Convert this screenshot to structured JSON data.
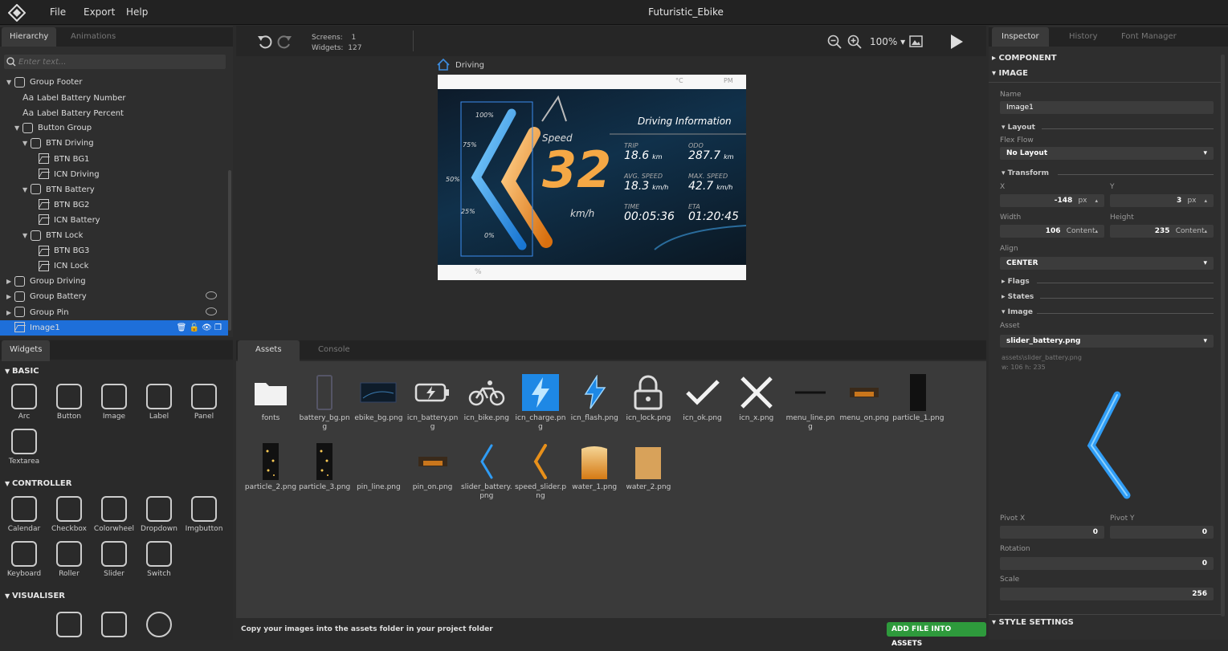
{
  "app": {
    "title": "Futuristic_Ebike",
    "menu": [
      "File",
      "Export",
      "Help"
    ]
  },
  "left_tabs": [
    "Hierarchy",
    "Animations"
  ],
  "search": {
    "placeholder": "Enter text..."
  },
  "hierarchy": [
    {
      "label": "Group Footer",
      "type": "group",
      "indent": 0,
      "expanded": true
    },
    {
      "label": "Label Battery Number",
      "type": "label",
      "indent": 1
    },
    {
      "label": "Label Battery Percent",
      "type": "label",
      "indent": 1
    },
    {
      "label": "Button Group",
      "type": "group",
      "indent": 1,
      "expanded": true
    },
    {
      "label": "BTN Driving",
      "type": "group",
      "indent": 2,
      "expanded": true
    },
    {
      "label": "BTN BG1",
      "type": "image",
      "indent": 3
    },
    {
      "label": "ICN Driving",
      "type": "image",
      "indent": 3
    },
    {
      "label": "BTN Battery",
      "type": "group",
      "indent": 2,
      "expanded": true
    },
    {
      "label": "BTN BG2",
      "type": "image",
      "indent": 3
    },
    {
      "label": "ICN Battery",
      "type": "image",
      "indent": 3
    },
    {
      "label": "BTN Lock",
      "type": "group",
      "indent": 2,
      "expanded": true
    },
    {
      "label": "BTN BG3",
      "type": "image",
      "indent": 3
    },
    {
      "label": "ICN Lock",
      "type": "image",
      "indent": 3
    },
    {
      "label": "Group Driving",
      "type": "group",
      "indent": 0,
      "expanded": false
    },
    {
      "label": "Group Battery",
      "type": "group",
      "indent": 0,
      "expanded": false,
      "hidden": true
    },
    {
      "label": "Group Pin",
      "type": "group",
      "indent": 0,
      "expanded": false,
      "hidden": true
    },
    {
      "label": "Image1",
      "type": "image",
      "indent": 0,
      "selected": true
    }
  ],
  "widgets_tab": "Widgets",
  "widget_sections": [
    {
      "name": "BASIC",
      "items": [
        "Arc",
        "Button",
        "Image",
        "Label",
        "Panel",
        "Textarea"
      ]
    },
    {
      "name": "CONTROLLER",
      "items": [
        "Calendar",
        "Checkbox",
        "Colorwheel",
        "Dropdown",
        "Imgbutton",
        "Keyboard",
        "Roller",
        "Slider",
        "Switch"
      ]
    },
    {
      "name": "VISUALISER",
      "items": []
    }
  ],
  "toolbar": {
    "screens_label": "Screens:",
    "screens": "1",
    "widgets_label": "Widgets:",
    "widgets": "127",
    "zoom": "100%"
  },
  "canvas": {
    "screen_name": "Driving",
    "header": {
      "temp_unit": "°C",
      "ampm": "PM"
    },
    "panel_title": "Driving Information",
    "speed_label": "Speed",
    "speed": "32",
    "speed_unit": "km/h",
    "scale": [
      "100%",
      "75%",
      "50%",
      "25%",
      "0%"
    ],
    "stats": [
      {
        "label": "TRIP",
        "value": "18.6",
        "unit": "km"
      },
      {
        "label": "ODO",
        "value": "287.7",
        "unit": "km"
      },
      {
        "label": "AVG. SPEED",
        "value": "18.3",
        "unit": "km/h"
      },
      {
        "label": "MAX. SPEED",
        "value": "42.7",
        "unit": "km/h"
      },
      {
        "label": "TIME",
        "value": "00:05:36",
        "unit": ""
      },
      {
        "label": "ETA",
        "value": "01:20:45",
        "unit": ""
      }
    ],
    "footer_percent": "%"
  },
  "bottom_tabs": [
    "Assets",
    "Console"
  ],
  "assets": [
    {
      "name": "fonts",
      "kind": "folder"
    },
    {
      "name": "battery_bg.png",
      "kind": "battery"
    },
    {
      "name": "ebike_bg.png",
      "kind": "bg"
    },
    {
      "name": "icn_battery.png",
      "kind": "icn_battery"
    },
    {
      "name": "icn_bike.png",
      "kind": "bike"
    },
    {
      "name": "icn_charge.png",
      "kind": "charge"
    },
    {
      "name": "icn_flash.png",
      "kind": "flash"
    },
    {
      "name": "icn_lock.png",
      "kind": "lock"
    },
    {
      "name": "icn_ok.png",
      "kind": "ok"
    },
    {
      "name": "icn_x.png",
      "kind": "x"
    },
    {
      "name": "menu_line.png",
      "kind": "line"
    },
    {
      "name": "menu_on.png",
      "kind": "menu_on"
    },
    {
      "name": "particle_1.png",
      "kind": "particle"
    },
    {
      "name": "particle_2.png",
      "kind": "particle2"
    },
    {
      "name": "particle_3.png",
      "kind": "particle2"
    },
    {
      "name": "pin_line.png",
      "kind": "empty"
    },
    {
      "name": "pin_on.png",
      "kind": "menu_on"
    },
    {
      "name": "slider_battery.png",
      "kind": "slider_blue"
    },
    {
      "name": "speed_slider.png",
      "kind": "slider_orange"
    },
    {
      "name": "water_1.png",
      "kind": "water1"
    },
    {
      "name": "water_2.png",
      "kind": "water2"
    }
  ],
  "assets_hint": "Copy your images into the assets folder in your project folder",
  "add_button": "ADD FILE INTO ASSETS",
  "inspector": {
    "tabs": [
      "Inspector",
      "History",
      "Font Manager"
    ],
    "component": "COMPONENT",
    "image_section": "IMAGE",
    "name_label": "Name",
    "name": "Image1",
    "layout": "Layout",
    "flex_flow_label": "Flex Flow",
    "flex_flow": "No Layout",
    "transform": "Transform",
    "x_label": "X",
    "x": "-148",
    "y_label": "Y",
    "y": "3",
    "px": "px",
    "width_label": "Width",
    "width": "106",
    "height_label": "Height",
    "height": "235",
    "content": "Content",
    "align_label": "Align",
    "align": "CENTER",
    "flags": "Flags",
    "states": "States",
    "image": "Image",
    "asset_label": "Asset",
    "asset": "slider_battery.png",
    "asset_path": "assets\\slider_battery.png",
    "asset_size": "w: 106  h: 235",
    "pivot_x_label": "Pivot X",
    "pivot_x": "0",
    "pivot_y_label": "Pivot Y",
    "pivot_y": "0",
    "rotation_label": "Rotation",
    "rotation": "0",
    "scale_label": "Scale",
    "scale": "256",
    "style_settings": "STYLE SETTINGS"
  },
  "colors": {
    "accent": "#1e6fd9",
    "orange": "#e8901a",
    "blue": "#2f9cf5",
    "green": "#2e9a3c"
  }
}
